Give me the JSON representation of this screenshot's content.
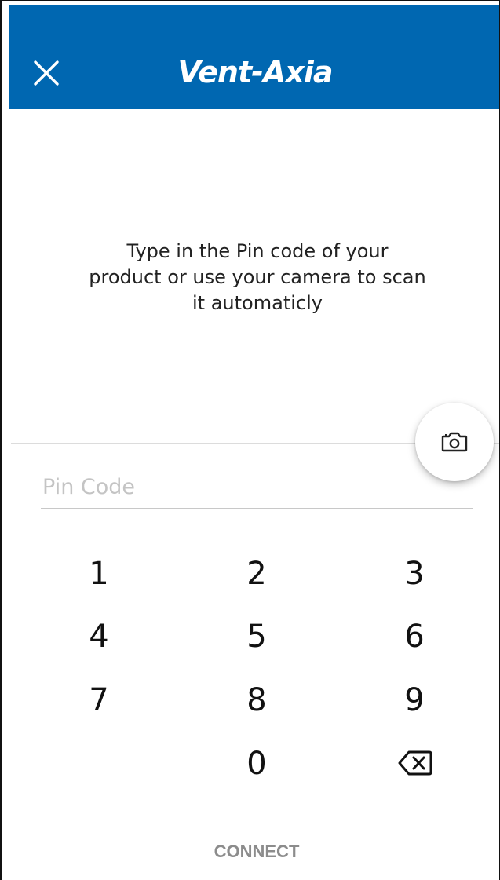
{
  "header": {
    "brand_logo": "Vent-Axia",
    "background_color": "#0067b1",
    "close_icon": "close-icon"
  },
  "instruction": {
    "text": "Type in the Pin code of your product or use your camera to scan it automaticly"
  },
  "camera_button": {
    "icon": "camera-icon"
  },
  "pin_input": {
    "value": "",
    "placeholder": "Pin Code"
  },
  "keypad": {
    "k1": "1",
    "k2": "2",
    "k3": "3",
    "k4": "4",
    "k5": "5",
    "k6": "6",
    "k7": "7",
    "k8": "8",
    "k9": "9",
    "k0": "0",
    "delete_icon": "backspace-icon"
  },
  "connect_button": {
    "label": "CONNECT",
    "color": "#8c8c8c"
  }
}
